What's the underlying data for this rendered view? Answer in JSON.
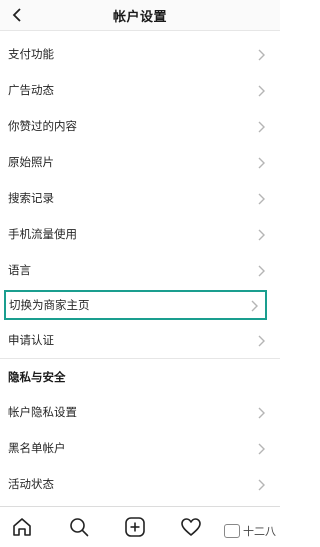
{
  "header": {
    "title": "帐户设置",
    "back_icon": "chevron-left-icon"
  },
  "items": [
    {
      "label": "支付功能"
    },
    {
      "label": "广告动态"
    },
    {
      "label": "你赞过的内容"
    },
    {
      "label": "原始照片"
    },
    {
      "label": "搜索记录"
    },
    {
      "label": "手机流量使用"
    },
    {
      "label": "语言"
    },
    {
      "label": "切换为商家主页",
      "highlighted": true
    },
    {
      "label": "申请认证"
    }
  ],
  "privacy_section": {
    "title": "隐私与安全",
    "items": [
      {
        "label": "帐户隐私设置"
      },
      {
        "label": "黑名单帐户"
      },
      {
        "label": "活动状态"
      }
    ]
  },
  "tabbar": {
    "tabs": [
      "home-icon",
      "search-icon",
      "new-post-icon",
      "heart-icon"
    ],
    "watermark": "十二八"
  },
  "colors": {
    "highlight": "#1a9e8f",
    "divider": "#e6e6e6"
  }
}
